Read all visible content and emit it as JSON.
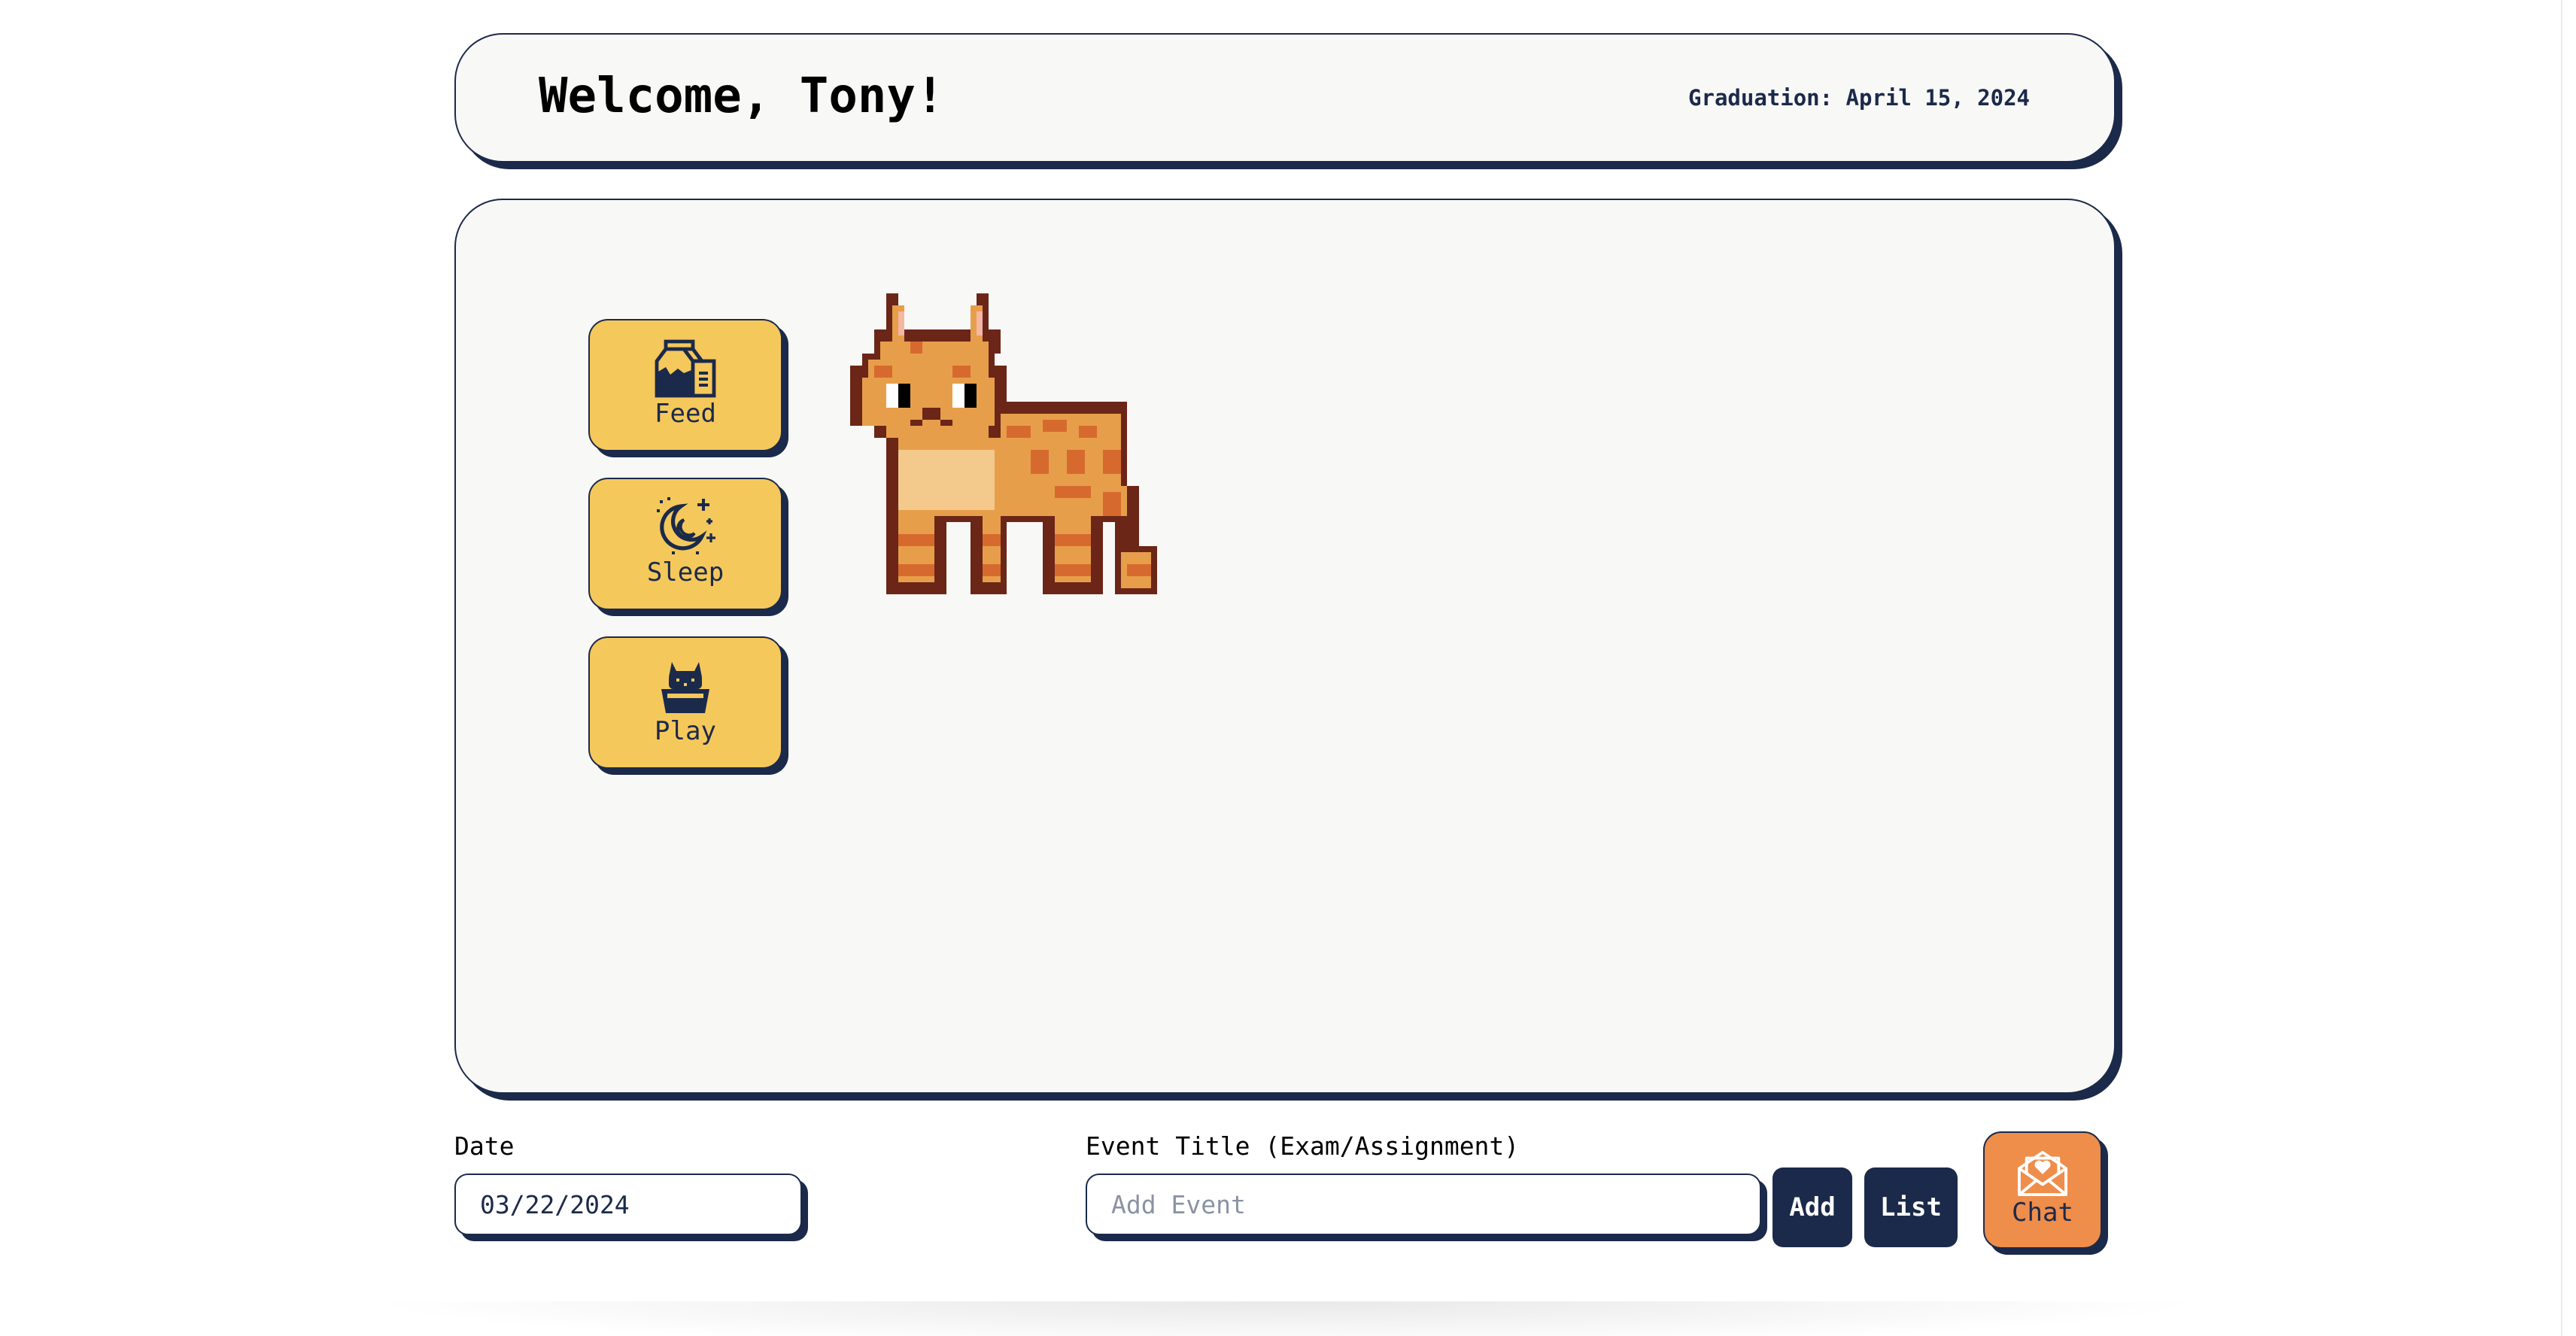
{
  "header": {
    "welcome": "Welcome, Tony!",
    "graduation": "Graduation: April 15, 2024"
  },
  "actions": {
    "feed_label": "Feed",
    "sleep_label": "Sleep",
    "play_label": "Play"
  },
  "icons": {
    "feed": "milk-carton-icon",
    "sleep": "moon-stars-icon",
    "play": "cat-in-box-icon",
    "chat": "love-letter-icon"
  },
  "pet": {
    "name": "cat-sprite"
  },
  "form": {
    "date_label": "Date",
    "date_value": "03/22/2024",
    "event_label": "Event Title (Exam/Assignment)",
    "event_placeholder": "Add Event",
    "add_label": "Add",
    "list_label": "List",
    "chat_label": "Chat"
  },
  "colors": {
    "navy": "#1b2a4a",
    "button_yellow": "#f5c85c",
    "chat_orange": "#ef8d4a",
    "card_bg": "#f8f8f6",
    "cat_orange": "#e79e4a",
    "cat_stripe": "#d66a2e",
    "cat_outline": "#6b2618"
  }
}
